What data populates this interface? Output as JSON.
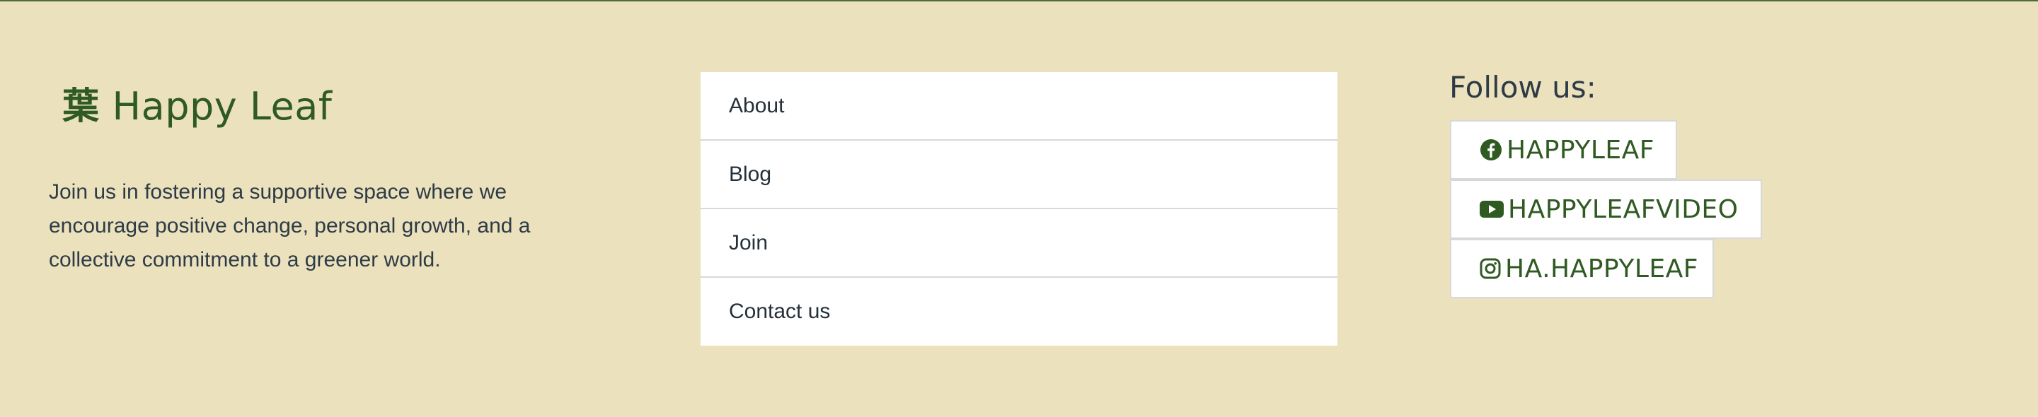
{
  "brand": {
    "icon_glyph": "葉",
    "name": "Happy Leaf"
  },
  "about": {
    "text": "Join us in fostering a supportive space where we encourage positive change, personal growth, and a collective commitment to a greener world."
  },
  "nav": {
    "items": [
      {
        "label": "About"
      },
      {
        "label": "Blog"
      },
      {
        "label": "Join"
      },
      {
        "label": "Contact us"
      }
    ]
  },
  "social": {
    "heading": "Follow us:",
    "links": [
      {
        "label": "HAPPYLEAF",
        "icon": "facebook-icon"
      },
      {
        "label": "HAPPYLEAFVIDEO",
        "icon": "youtube-icon"
      },
      {
        "label": "HA.HAPPYLEAF",
        "icon": "instagram-icon"
      }
    ]
  },
  "colors": {
    "background": "#ebe1bd",
    "brand_green": "#2f5a22",
    "text": "#2e3b46"
  }
}
